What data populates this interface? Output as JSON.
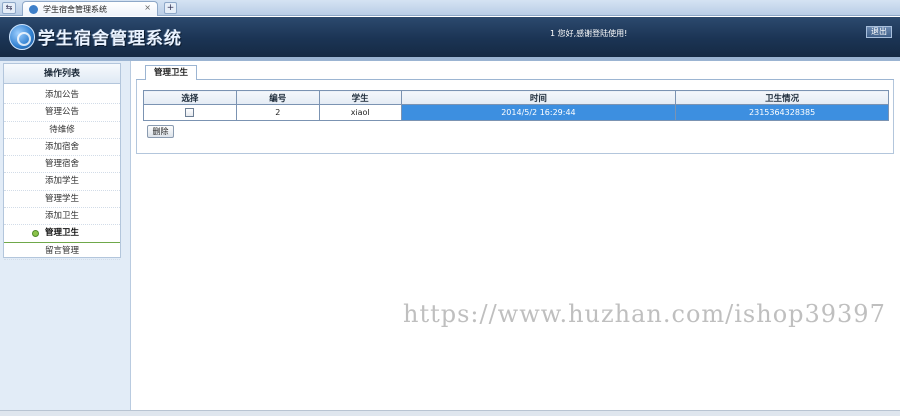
{
  "browser": {
    "nav_glyph": "⇆",
    "tab_title": "学生宿舍管理系统",
    "close_glyph": "×",
    "new_tab_glyph": "+"
  },
  "header": {
    "title": "学生宿舍管理系统",
    "welcome": "1 您好,感谢登陆使用!",
    "logout_label": "退出"
  },
  "sidebar": {
    "heading": "操作列表",
    "items": [
      {
        "label": "添加公告"
      },
      {
        "label": "管理公告"
      },
      {
        "label": "待维修"
      },
      {
        "label": "添加宿舍"
      },
      {
        "label": "管理宿舍"
      },
      {
        "label": "添加学生"
      },
      {
        "label": "管理学生"
      },
      {
        "label": "添加卫生"
      },
      {
        "label": "管理卫生",
        "active": true
      },
      {
        "label": "留言管理"
      }
    ]
  },
  "main": {
    "tab_label": "管理卫生",
    "table": {
      "headers": [
        "选择",
        "编号",
        "学生",
        "时间",
        "卫生情况"
      ],
      "rows": [
        {
          "id": "2",
          "student": "xiaol",
          "time": "2014/5/2 16:29:44",
          "hygiene": "2315364328385"
        }
      ]
    },
    "delete_label": "删除"
  },
  "watermark": "https://www.huzhan.com/ishop39397",
  "colors": {
    "header_bg": "#1b3454",
    "sidebar_bg": "#e2ecf7",
    "row_highlight": "#3d8fe0",
    "active_dot": "#8bc34a"
  }
}
